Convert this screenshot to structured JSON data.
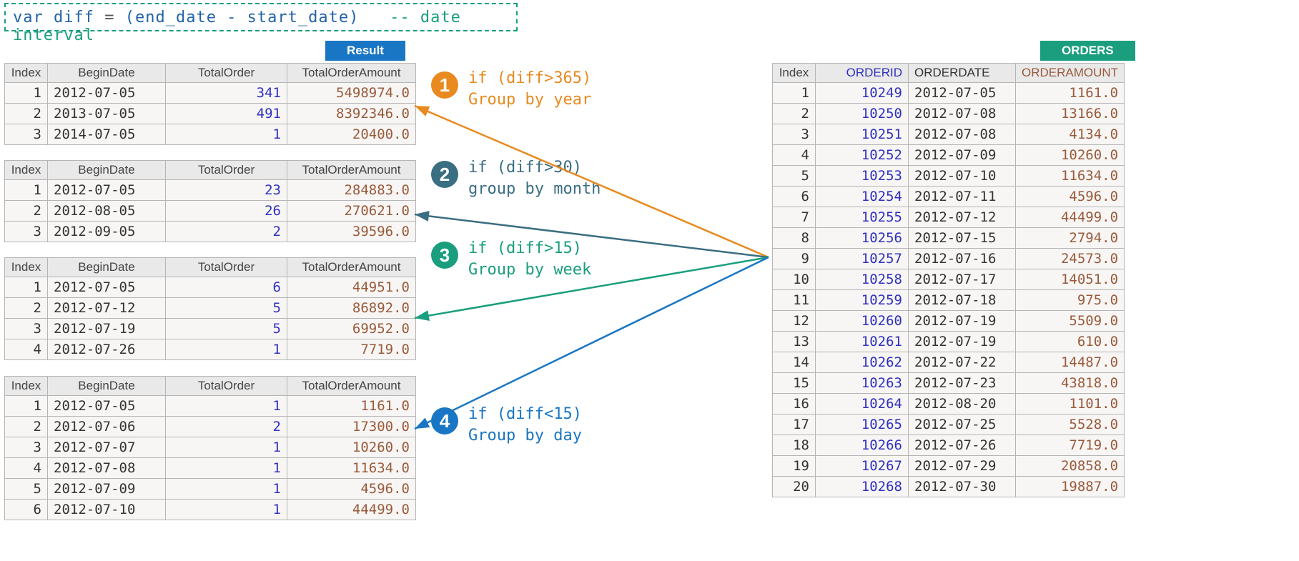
{
  "code": {
    "kw_var": "var",
    "ident": "diff",
    "eq": "=",
    "expr": "(end_date - start_date)",
    "comment": "-- date interval"
  },
  "tabs": {
    "result": "Result",
    "orders": "ORDERS"
  },
  "result_cols": [
    "Index",
    "BeginDate",
    "TotalOrder",
    "TotalOrderAmount"
  ],
  "orders_cols": [
    "Index",
    "ORDERID",
    "ORDERDATE",
    "ORDERAMOUNT"
  ],
  "tables": {
    "year": [
      {
        "idx": 1,
        "date": "2012-07-05",
        "ord": "341",
        "amt": "5498974.0"
      },
      {
        "idx": 2,
        "date": "2013-07-05",
        "ord": "491",
        "amt": "8392346.0"
      },
      {
        "idx": 3,
        "date": "2014-07-05",
        "ord": "1",
        "amt": "20400.0"
      }
    ],
    "month": [
      {
        "idx": 1,
        "date": "2012-07-05",
        "ord": "23",
        "amt": "284883.0"
      },
      {
        "idx": 2,
        "date": "2012-08-05",
        "ord": "26",
        "amt": "270621.0"
      },
      {
        "idx": 3,
        "date": "2012-09-05",
        "ord": "2",
        "amt": "39596.0"
      }
    ],
    "week": [
      {
        "idx": 1,
        "date": "2012-07-05",
        "ord": "6",
        "amt": "44951.0"
      },
      {
        "idx": 2,
        "date": "2012-07-12",
        "ord": "5",
        "amt": "86892.0"
      },
      {
        "idx": 3,
        "date": "2012-07-19",
        "ord": "5",
        "amt": "69952.0"
      },
      {
        "idx": 4,
        "date": "2012-07-26",
        "ord": "1",
        "amt": "7719.0"
      }
    ],
    "day": [
      {
        "idx": 1,
        "date": "2012-07-05",
        "ord": "1",
        "amt": "1161.0"
      },
      {
        "idx": 2,
        "date": "2012-07-06",
        "ord": "2",
        "amt": "17300.0"
      },
      {
        "idx": 3,
        "date": "2012-07-07",
        "ord": "1",
        "amt": "10260.0"
      },
      {
        "idx": 4,
        "date": "2012-07-08",
        "ord": "1",
        "amt": "11634.0"
      },
      {
        "idx": 5,
        "date": "2012-07-09",
        "ord": "1",
        "amt": "4596.0"
      },
      {
        "idx": 6,
        "date": "2012-07-10",
        "ord": "1",
        "amt": "44499.0"
      }
    ]
  },
  "orders": [
    {
      "idx": 1,
      "id": "10249",
      "date": "2012-07-05",
      "amt": "1161.0"
    },
    {
      "idx": 2,
      "id": "10250",
      "date": "2012-07-08",
      "amt": "13166.0"
    },
    {
      "idx": 3,
      "id": "10251",
      "date": "2012-07-08",
      "amt": "4134.0"
    },
    {
      "idx": 4,
      "id": "10252",
      "date": "2012-07-09",
      "amt": "10260.0"
    },
    {
      "idx": 5,
      "id": "10253",
      "date": "2012-07-10",
      "amt": "11634.0"
    },
    {
      "idx": 6,
      "id": "10254",
      "date": "2012-07-11",
      "amt": "4596.0"
    },
    {
      "idx": 7,
      "id": "10255",
      "date": "2012-07-12",
      "amt": "44499.0"
    },
    {
      "idx": 8,
      "id": "10256",
      "date": "2012-07-15",
      "amt": "2794.0"
    },
    {
      "idx": 9,
      "id": "10257",
      "date": "2012-07-16",
      "amt": "24573.0"
    },
    {
      "idx": 10,
      "id": "10258",
      "date": "2012-07-17",
      "amt": "14051.0"
    },
    {
      "idx": 11,
      "id": "10259",
      "date": "2012-07-18",
      "amt": "975.0"
    },
    {
      "idx": 12,
      "id": "10260",
      "date": "2012-07-19",
      "amt": "5509.0"
    },
    {
      "idx": 13,
      "id": "10261",
      "date": "2012-07-19",
      "amt": "610.0"
    },
    {
      "idx": 14,
      "id": "10262",
      "date": "2012-07-22",
      "amt": "14487.0"
    },
    {
      "idx": 15,
      "id": "10263",
      "date": "2012-07-23",
      "amt": "43818.0"
    },
    {
      "idx": 16,
      "id": "10264",
      "date": "2012-08-20",
      "amt": "1101.0"
    },
    {
      "idx": 17,
      "id": "10265",
      "date": "2012-07-25",
      "amt": "5528.0"
    },
    {
      "idx": 18,
      "id": "10266",
      "date": "2012-07-26",
      "amt": "7719.0"
    },
    {
      "idx": 19,
      "id": "10267",
      "date": "2012-07-29",
      "amt": "20858.0"
    },
    {
      "idx": 20,
      "id": "10268",
      "date": "2012-07-30",
      "amt": "19887.0"
    }
  ],
  "annot": {
    "a1": {
      "num": "1",
      "l1": "if (diff>365)",
      "l2": "Group by year"
    },
    "a2": {
      "num": "2",
      "l1": "if (diff>30)",
      "l2": "group by month"
    },
    "a3": {
      "num": "3",
      "l1": "if (diff>15)",
      "l2": "Group by week"
    },
    "a4": {
      "num": "4",
      "l1": "if (diff<15)",
      "l2": "Group by day"
    }
  }
}
